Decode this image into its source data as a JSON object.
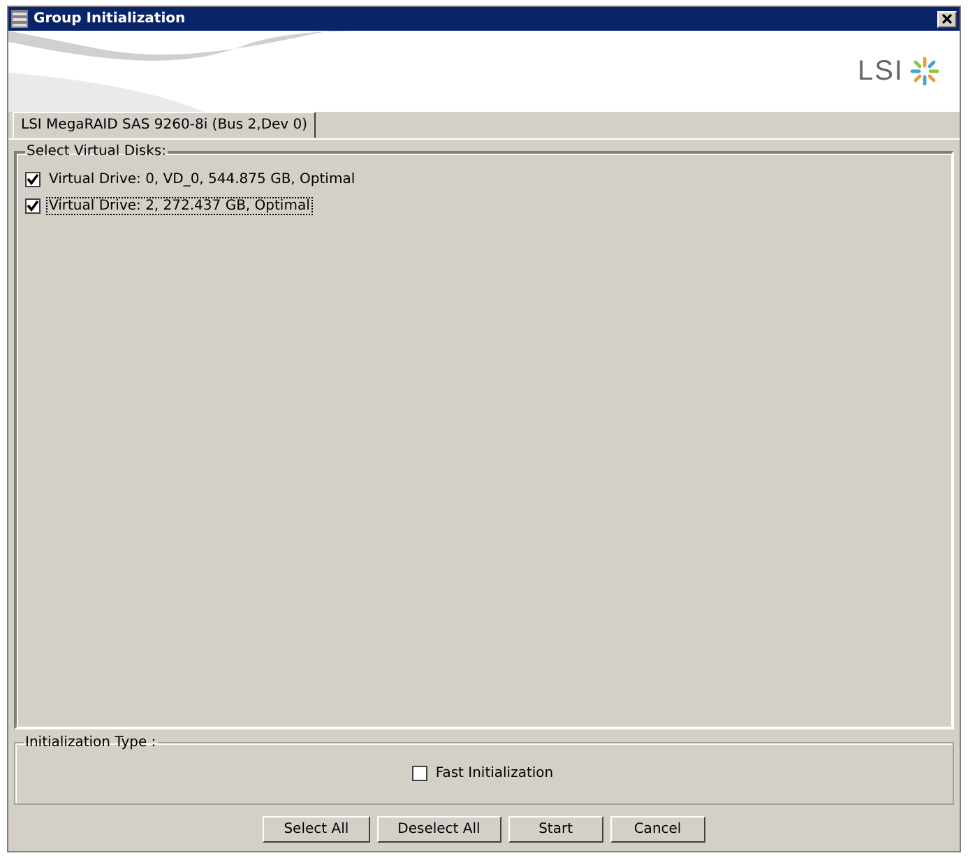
{
  "window": {
    "title": "Group Initialization"
  },
  "logo": {
    "text": "LSI"
  },
  "tabs": [
    {
      "label": "LSI MegaRAID SAS 9260-8i (Bus 2,Dev 0)",
      "selected": true
    }
  ],
  "virtual_disks": {
    "legend": "Select Virtual Disks:",
    "items": [
      {
        "label": "Virtual Drive: 0, VD_0, 544.875 GB, Optimal",
        "checked": true,
        "focused": false
      },
      {
        "label": "Virtual Drive: 2, 272.437 GB, Optimal",
        "checked": true,
        "focused": true
      }
    ]
  },
  "initialization_type": {
    "legend": "Initialization Type :",
    "option": {
      "label": "Fast Initialization",
      "checked": false
    }
  },
  "buttons": [
    "Select All",
    "Deselect All",
    "Start",
    "Cancel"
  ]
}
